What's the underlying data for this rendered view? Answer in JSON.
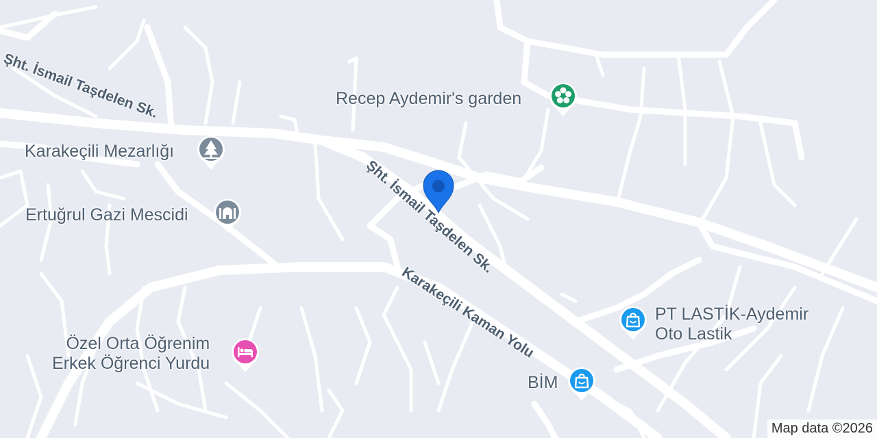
{
  "map": {
    "background": "#e8ebf2",
    "road_color": "#ffffff",
    "streets": [
      {
        "id": "street-1",
        "label": "Şht. İsmail Taşdelen Sk."
      },
      {
        "id": "street-2",
        "label": "Şht. İsmail Taşdelen Sk."
      },
      {
        "id": "street-3",
        "label": "Karakeçili Kaman Yolu"
      }
    ],
    "pois": [
      {
        "id": "recep",
        "label": "Recep Aydemir's garden",
        "icon": "flower-icon",
        "color": "#1e9e6a"
      },
      {
        "id": "mezarlik",
        "label": "Karakeçili Mezarlığı",
        "icon": "tree-icon",
        "color": "#7b8b9a"
      },
      {
        "id": "mescidi",
        "label": "Ertuğrul Gazi Mescidi",
        "icon": "mosque-icon",
        "color": "#7b8b9a"
      },
      {
        "id": "yurt",
        "label_lines": [
          "Özel Orta Öğrenim",
          "Erkek Öğrenci Yurdu"
        ],
        "icon": "bed-icon",
        "color": "#e84fb2"
      },
      {
        "id": "lastik",
        "label_lines": [
          "PT LASTİK-Aydemir",
          "Oto Lastik"
        ],
        "icon": "shopping-bag-icon",
        "color": "#1a9bf0"
      },
      {
        "id": "bim",
        "label": "BİM",
        "icon": "shopping-bag-icon",
        "color": "#1a9bf0"
      }
    ],
    "location_marker": {
      "icon": "location-pin-icon",
      "color": "#1a73e8"
    },
    "attribution": "Map data ©2026"
  }
}
